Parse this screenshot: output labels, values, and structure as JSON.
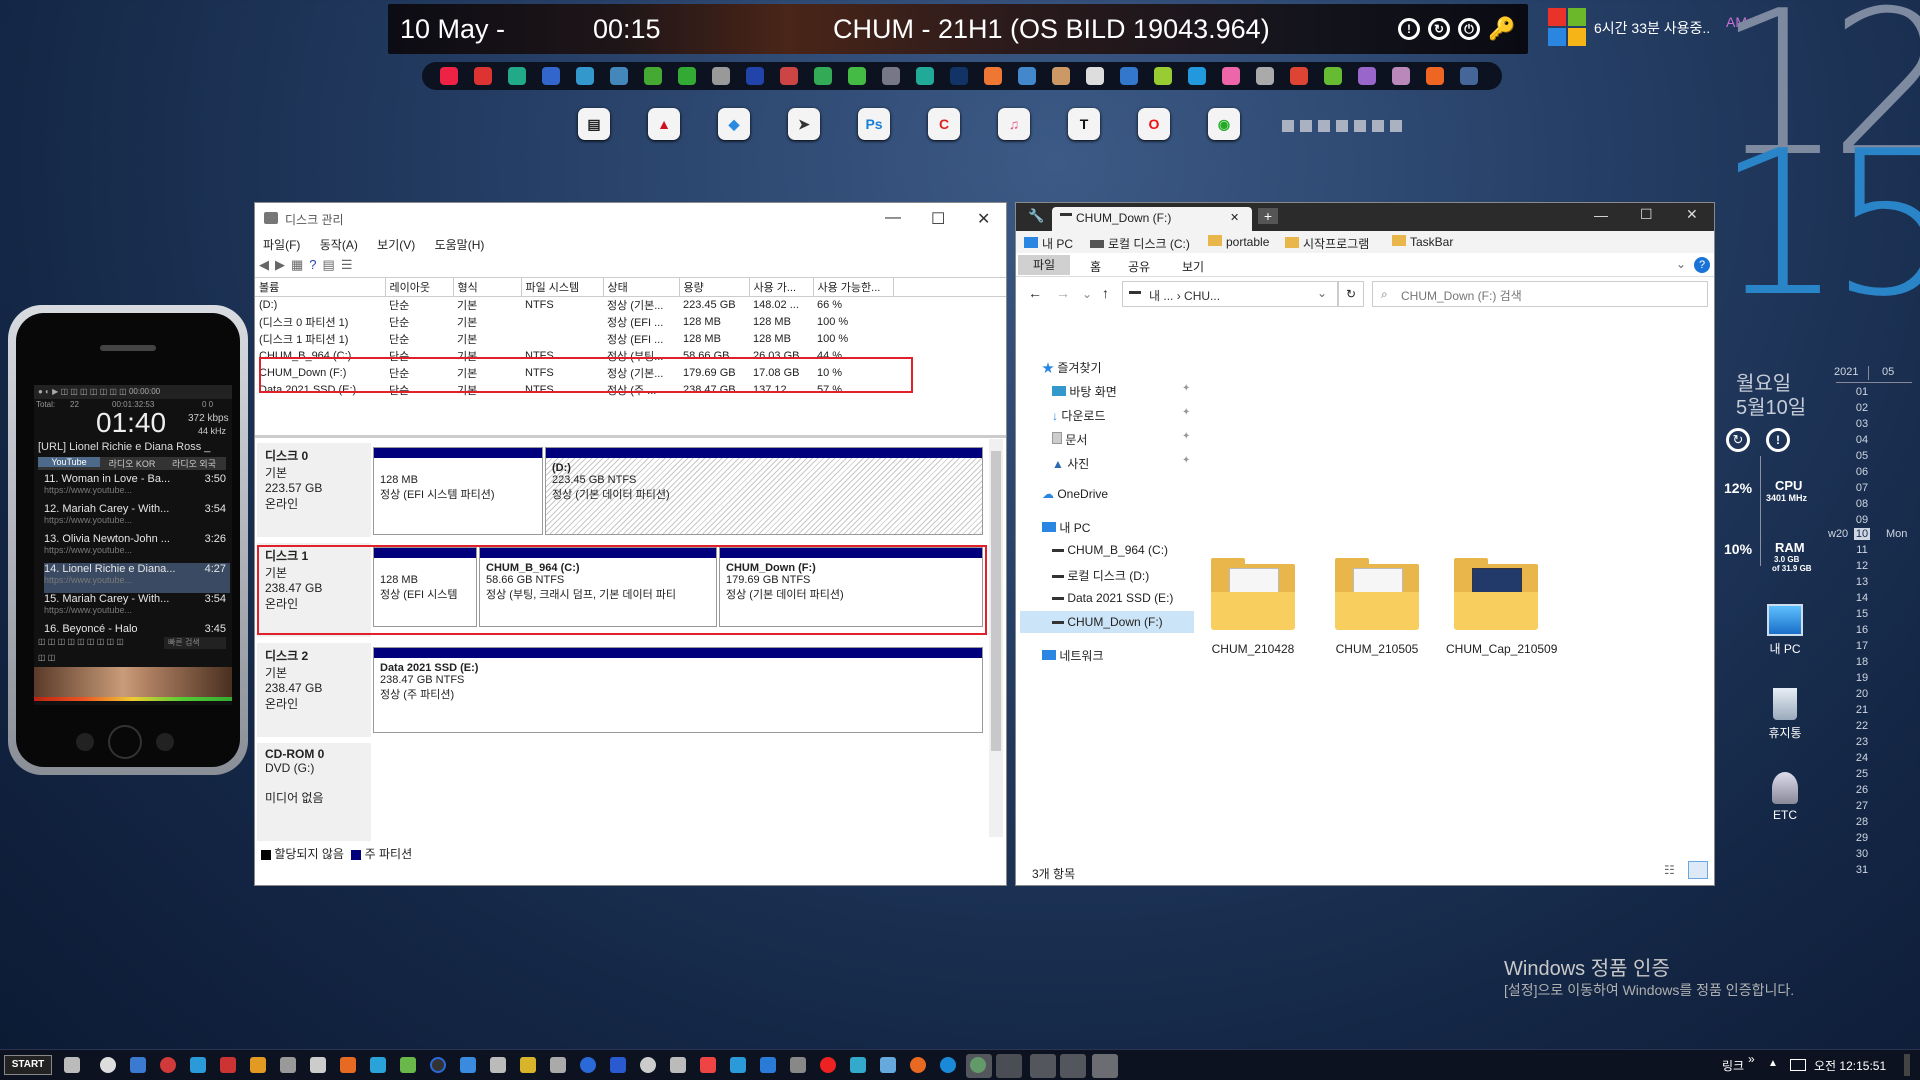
{
  "topbar": {
    "date": "10 May -",
    "time": "00:15",
    "build": "CHUM - 21H1 (OS BILD 19043.964)"
  },
  "widgets": {
    "session": "6시간 33분 사용중..",
    "ampm": "AM",
    "clock_hour": "12",
    "clock_min": "15",
    "weekday": "월요일",
    "monthday": "5월10일",
    "cal_year": "2021",
    "cal_month": "05",
    "week": "w20",
    "weekday_short": "Mon",
    "cal_days": [
      "01",
      "02",
      "03",
      "04",
      "05",
      "06",
      "07",
      "08",
      "09",
      "10",
      "11",
      "12",
      "13",
      "14",
      "15",
      "16",
      "17",
      "18",
      "19",
      "20",
      "21",
      "22",
      "23",
      "24",
      "25",
      "26",
      "27",
      "28",
      "29",
      "30",
      "31"
    ],
    "cpu_pct": "12%",
    "cpu_label": "CPU",
    "cpu_mhz": "3401 MHz",
    "ram_pct": "10%",
    "ram_label": "RAM",
    "ram_used": "3.0 GB",
    "ram_total": "of 31.9 GB"
  },
  "desktop": {
    "icons": [
      "내 PC",
      "휴지통",
      "ETC"
    ]
  },
  "player": {
    "total": "Total:",
    "total_n": "22",
    "elapsed": "00:01:32:53",
    "count": "0 0",
    "time": "01:40",
    "kbps": "372 kbps",
    "khz": "44 kHz",
    "now": "[URL] Lionel Richie e Diana Ross _",
    "tabs": [
      "YouTube",
      "라디오 KOR",
      "라디오 외국"
    ],
    "tracks": [
      {
        "t": "11. Woman in Love - Ba...",
        "d": "3:50",
        "u": "https://www.youtube..."
      },
      {
        "t": "12. Mariah Carey - With...",
        "d": "3:54",
        "u": "https://www.youtube..."
      },
      {
        "t": "13. Olivia Newton-John ...",
        "d": "3:26",
        "u": "https://www.youtube..."
      },
      {
        "t": "14. Lionel Richie e Diana...",
        "d": "4:27",
        "u": "https://www.youtube..."
      },
      {
        "t": "15. Mariah Carey - With...",
        "d": "3:54",
        "u": "https://www.youtube..."
      },
      {
        "t": "16. Beyoncé - Halo",
        "d": "3:45",
        "u": ""
      }
    ],
    "search": "빠른 검색"
  },
  "diskmgmt": {
    "title": "디스크 관리",
    "menu": [
      "파일(F)",
      "동작(A)",
      "보기(V)",
      "도움말(H)"
    ],
    "cols": [
      "볼륨",
      "레이아웃",
      "형식",
      "파일 시스템",
      "상태",
      "용량",
      "사용 가...",
      "사용 가능한..."
    ],
    "rows": [
      [
        "(D:)",
        "단순",
        "기본",
        "NTFS",
        "정상 (기본...",
        "223.45 GB",
        "148.02 ...",
        "66 %"
      ],
      [
        "(디스크 0 파티션 1)",
        "단순",
        "기본",
        "",
        "정상 (EFI ...",
        "128 MB",
        "128 MB",
        "100 %"
      ],
      [
        "(디스크 1 파티션 1)",
        "단순",
        "기본",
        "",
        "정상 (EFI ...",
        "128 MB",
        "128 MB",
        "100 %"
      ],
      [
        "CHUM_B_964 (C:)",
        "단순",
        "기본",
        "NTFS",
        "정상 (부팅...",
        "58.66 GB",
        "26.03 GB",
        "44 %"
      ],
      [
        "CHUM_Down (F:)",
        "단순",
        "기본",
        "NTFS",
        "정상 (기본...",
        "179.69 GB",
        "17.08 GB",
        "10 %"
      ],
      [
        "Data 2021 SSD (E:)",
        "단순",
        "기본",
        "NTFS",
        "정상 (주 ...",
        "238.47 GB",
        "137.12 ...",
        "57 %"
      ]
    ],
    "disks": [
      {
        "name": "디스크 0",
        "type": "기본",
        "size": "223.57 GB",
        "state": "온라인"
      },
      {
        "name": "디스크 1",
        "type": "기본",
        "size": "238.47 GB",
        "state": "온라인"
      },
      {
        "name": "디스크 2",
        "type": "기본",
        "size": "238.47 GB",
        "state": "온라인"
      },
      {
        "name": "CD-ROM 0",
        "type": "DVD (G:)",
        "size": "",
        "state": "미디어 없음"
      }
    ],
    "parts": {
      "d0p1a": "128 MB",
      "d0p1b": "정상 (EFI 시스템 파티션)",
      "d0p2t": "(D:)",
      "d0p2a": "223.45 GB NTFS",
      "d0p2b": "정상 (기본 데이터 파티션)",
      "d1p1a": "128 MB",
      "d1p1b": "정상 (EFI 시스템",
      "d1p2t": "CHUM_B_964  (C:)",
      "d1p2a": "58.66 GB NTFS",
      "d1p2b": "정상 (부팅, 크래시 덤프, 기본 데이터 파티",
      "d1p3t": "CHUM_Down  (F:)",
      "d1p3a": "179.69 GB NTFS",
      "d1p3b": "정상 (기본 데이터 파티션)",
      "d2p1t": "Data 2021 SSD  (E:)",
      "d2p1a": "238.47 GB NTFS",
      "d2p1b": "정상 (주 파티션)"
    },
    "legend_unalloc": "할당되지 않음",
    "legend_primary": "주 파티션"
  },
  "explorer": {
    "tab": "CHUM_Down (F:)",
    "bookmarks": [
      "내 PC",
      "로컬 디스크 (C:)",
      "portable",
      "시작프로그램",
      "TaskBar"
    ],
    "ribbon": [
      "파일",
      "홈",
      "공유",
      "보기"
    ],
    "address": "내 ...  ›  CHU...",
    "search": "CHUM_Down (F:) 검색",
    "nav": {
      "quick": "즐겨찾기",
      "desktop": "바탕 화면",
      "down": "다운로드",
      "docs": "문서",
      "pics": "사진",
      "onedrive": "OneDrive",
      "pc": "내 PC",
      "c": "CHUM_B_964 (C:)",
      "d": "로컬 디스크 (D:)",
      "e": "Data 2021 SSD (E:)",
      "f": "CHUM_Down (F:)",
      "net": "네트워크"
    },
    "folders": [
      "CHUM_210428",
      "CHUM_210505",
      "CHUM_Cap_210509"
    ],
    "status": "3개 항목"
  },
  "watermark": {
    "line1": "Windows 정품 인증",
    "line2": "[설정]으로 이동하여 Windows를 정품 인증합니다."
  },
  "taskbar": {
    "start": "START",
    "links": "링크",
    "clock": "오전 12:15:51"
  }
}
